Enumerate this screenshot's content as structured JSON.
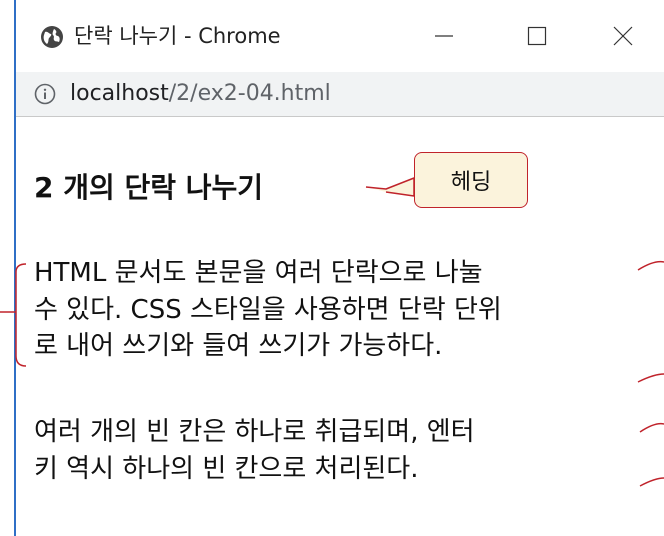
{
  "window": {
    "title": "단락 나누기 - Chrome"
  },
  "address_bar": {
    "url_host": "localhost",
    "url_path": "/2/ex2-04.html"
  },
  "page": {
    "heading": "2 개의 단락 나누기",
    "paragraph1_lines": [
      "HTML 문서도 본문을 여러 단락으로 나눌",
      "수 있다. CSS 스타일을 사용하면 단락 단위",
      "로 내어 쓰기와 들여 쓰기가 가능하다."
    ],
    "paragraph2_lines": [
      "여러 개의 빈 칸은 하나로 취급되며, 엔터",
      "키 역시 하나의 빈 칸으로 처리된다."
    ]
  },
  "annotation": {
    "callout_label": "헤딩",
    "color": "#c0232b",
    "fill": "#fbf3dc"
  },
  "icons": {
    "app": "globe-icon",
    "info": "info-icon",
    "minimize": "minimize-icon",
    "maximize": "maximize-icon",
    "close": "close-icon"
  }
}
